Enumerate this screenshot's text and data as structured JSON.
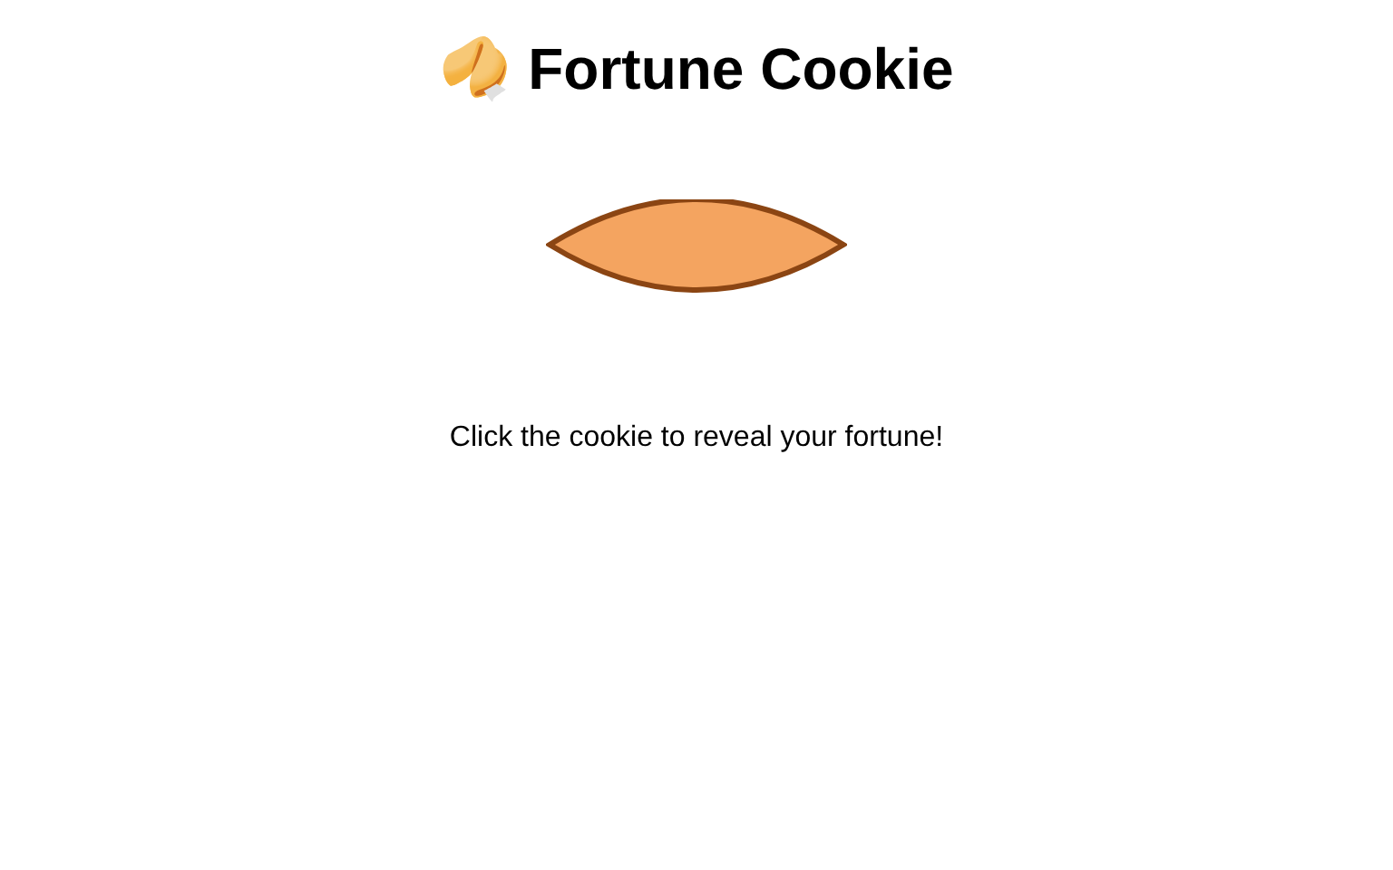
{
  "title": "🥠 Fortune Cookie",
  "hint": "Click the cookie to reveal your fortune!"
}
